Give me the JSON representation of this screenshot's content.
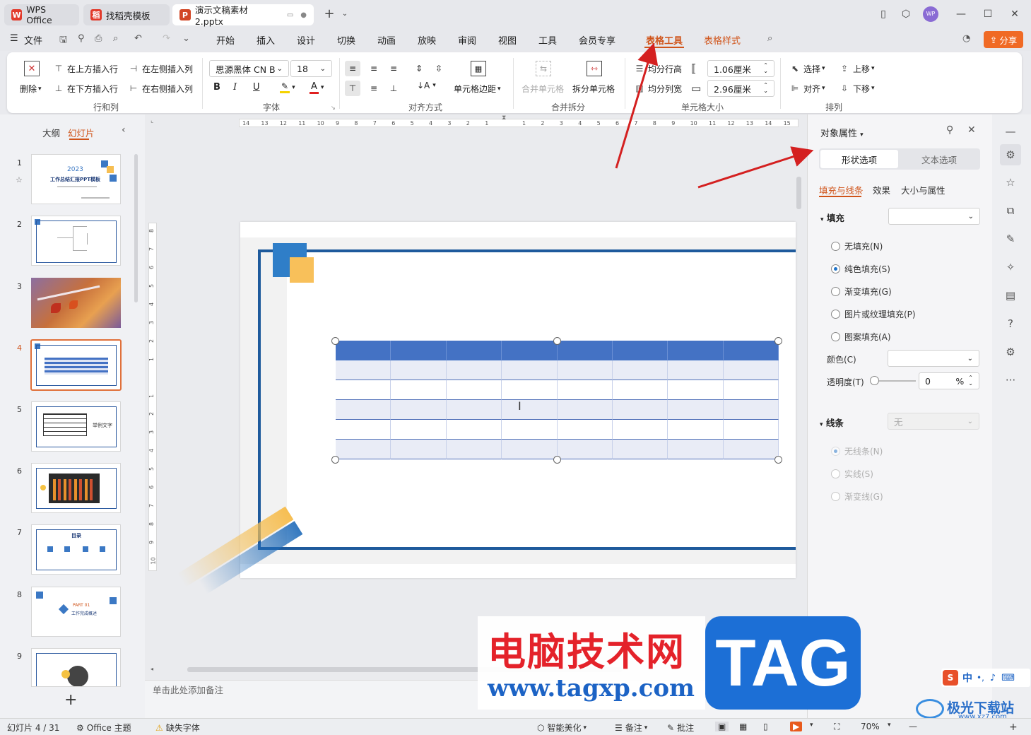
{
  "titlebar": {
    "tabs": [
      {
        "label": "WPS Office",
        "logo": "W",
        "color": "#e23a2b"
      },
      {
        "label": "找稻壳模板",
        "logo": "稻",
        "color": "#e23a2b"
      },
      {
        "label": "演示文稿素材2.pptx",
        "logo": "P",
        "color": "#d24726"
      }
    ],
    "avatar": "WP"
  },
  "menu": {
    "file": "文件",
    "items": [
      "开始",
      "插入",
      "设计",
      "切换",
      "动画",
      "放映",
      "审阅",
      "视图",
      "工具",
      "会员专享"
    ],
    "table_tools": "表格工具",
    "table_style": "表格样式",
    "share": "分享"
  },
  "ribbon": {
    "rows_cols": {
      "delete": "删除",
      "insert_above": "在上方插入行",
      "insert_below": "在下方插入行",
      "insert_left": "在左侧插入列",
      "insert_right": "在右侧插入列",
      "group": "行和列"
    },
    "font": {
      "name": "思源黑体 CN B",
      "size": "18",
      "bold": "B",
      "italic": "I",
      "underline": "U",
      "group": "字体"
    },
    "align": {
      "cell_margin": "单元格边距",
      "group": "对齐方式"
    },
    "merge": {
      "merge_cells": "合并单元格",
      "split_cells": "拆分单元格",
      "group": "合并拆分"
    },
    "cell_size": {
      "distribute_rows": "均分行高",
      "distribute_cols": "均分列宽",
      "height": "1.06厘米",
      "width": "2.96厘米",
      "group": "单元格大小"
    },
    "arrange": {
      "select": "选择",
      "align": "对齐",
      "bring_up": "上移",
      "send_down": "下移",
      "group": "排列"
    }
  },
  "left_panel": {
    "outline_tab": "大纲",
    "slides_tab": "幻灯片",
    "slide_numbers": [
      "1",
      "2",
      "3",
      "4",
      "5",
      "6",
      "7",
      "8",
      "9"
    ],
    "slide1_year": "2023",
    "slide1_title": "工作总结汇报PPT模板",
    "slide5_text": "举例文字",
    "slide7_title": "目录",
    "slide8_num": "PART 01",
    "slide8_text": "工作完成概述"
  },
  "ruler": {
    "top": [
      "14",
      "13",
      "12",
      "11",
      "10",
      "9",
      "8",
      "7",
      "6",
      "5",
      "4",
      "3",
      "2",
      "1",
      "",
      "1",
      "2",
      "3",
      "4",
      "5",
      "6",
      "7",
      "8",
      "9",
      "10",
      "11",
      "12",
      "13",
      "14",
      "15"
    ],
    "left": [
      "8",
      "7",
      "6",
      "5",
      "4",
      "3",
      "2",
      "1",
      "",
      "1",
      "2",
      "3",
      "4",
      "5",
      "6",
      "7",
      "8",
      "9",
      "10"
    ]
  },
  "table": {
    "rows": 6,
    "cols": 8,
    "header_color": "#4472c4",
    "band_color": "#e9ecf6"
  },
  "notes_placeholder": "单击此处添加备注",
  "properties": {
    "title": "对象属性",
    "tab_shape": "形状选项",
    "tab_text": "文本选项",
    "sub_fill_line": "填充与线条",
    "sub_effect": "效果",
    "sub_size": "大小与属性",
    "fill_section": "填充",
    "fill_options": [
      "无填充(N)",
      "纯色填充(S)",
      "渐变填充(G)",
      "图片或纹理填充(P)",
      "图案填充(A)"
    ],
    "color_label": "颜色(C)",
    "transparency_label": "透明度(T)",
    "transparency_value": "0",
    "percent": "%",
    "line_section": "线条",
    "line_value": "无",
    "line_options": [
      "无线条(N)",
      "实线(S)",
      "渐变线(G)"
    ]
  },
  "status": {
    "slide_info": "幻灯片 4 / 31",
    "theme": "Office 主题",
    "missing_font": "缺失字体",
    "beautify": "智能美化",
    "notes": "备注",
    "comments": "批注",
    "zoom": "70%"
  },
  "watermark": {
    "cn": "电脑技术网",
    "url": "www.tagxp.com",
    "tag": "TAG",
    "site": "极光下载站",
    "site_url": "www.xz7.com",
    "ime": "中"
  },
  "colors": {
    "accent": "#d0541a",
    "annotation_arrow": "#d42020",
    "brand_blue": "#1e5a9c"
  }
}
